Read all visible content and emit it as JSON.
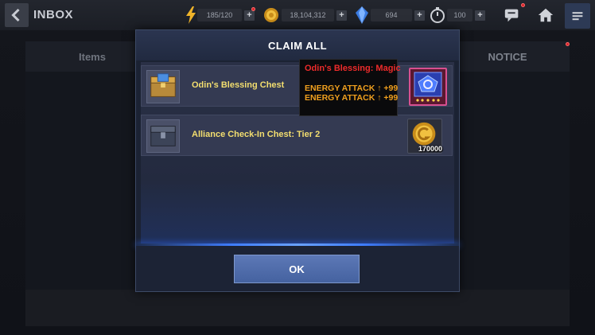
{
  "header": {
    "title": "INBOX",
    "energy": {
      "value": "185/120",
      "icon": "lightning-icon"
    },
    "gold": {
      "value": "18,104,312",
      "icon": "gold-coin-icon"
    },
    "crystal": {
      "value": "694",
      "icon": "blue-crystal-icon"
    },
    "stamina": {
      "value": "100",
      "icon": "timer-icon"
    },
    "plus_label": "+"
  },
  "tabs": {
    "items": "Items",
    "notice": "NOTICE"
  },
  "modal": {
    "title": "CLAIM ALL",
    "rows": [
      {
        "label": "Odin's Blessing Chest",
        "icon": "blessing-chest-icon",
        "reward_icon": "odin-blessing-badge-icon"
      },
      {
        "label": "Alliance Check-In Chest: Tier 2",
        "icon": "alliance-chest-icon",
        "reward_icon": "gold-coin-icon",
        "reward_amount": "170000"
      }
    ],
    "tooltip": {
      "title": "Odin's Blessing: Magic",
      "line1": "ENERGY ATTACK ↑ +99",
      "line2": "ENERGY ATTACK ↑ +99"
    },
    "ok_label": "OK"
  },
  "colors": {
    "accent_gold_text": "#f3de6f",
    "tooltip_title": "#ee2b2b",
    "tooltip_stat": "#f0a01e",
    "ok_button": "#5070ae",
    "glow": "#3f7dff"
  }
}
